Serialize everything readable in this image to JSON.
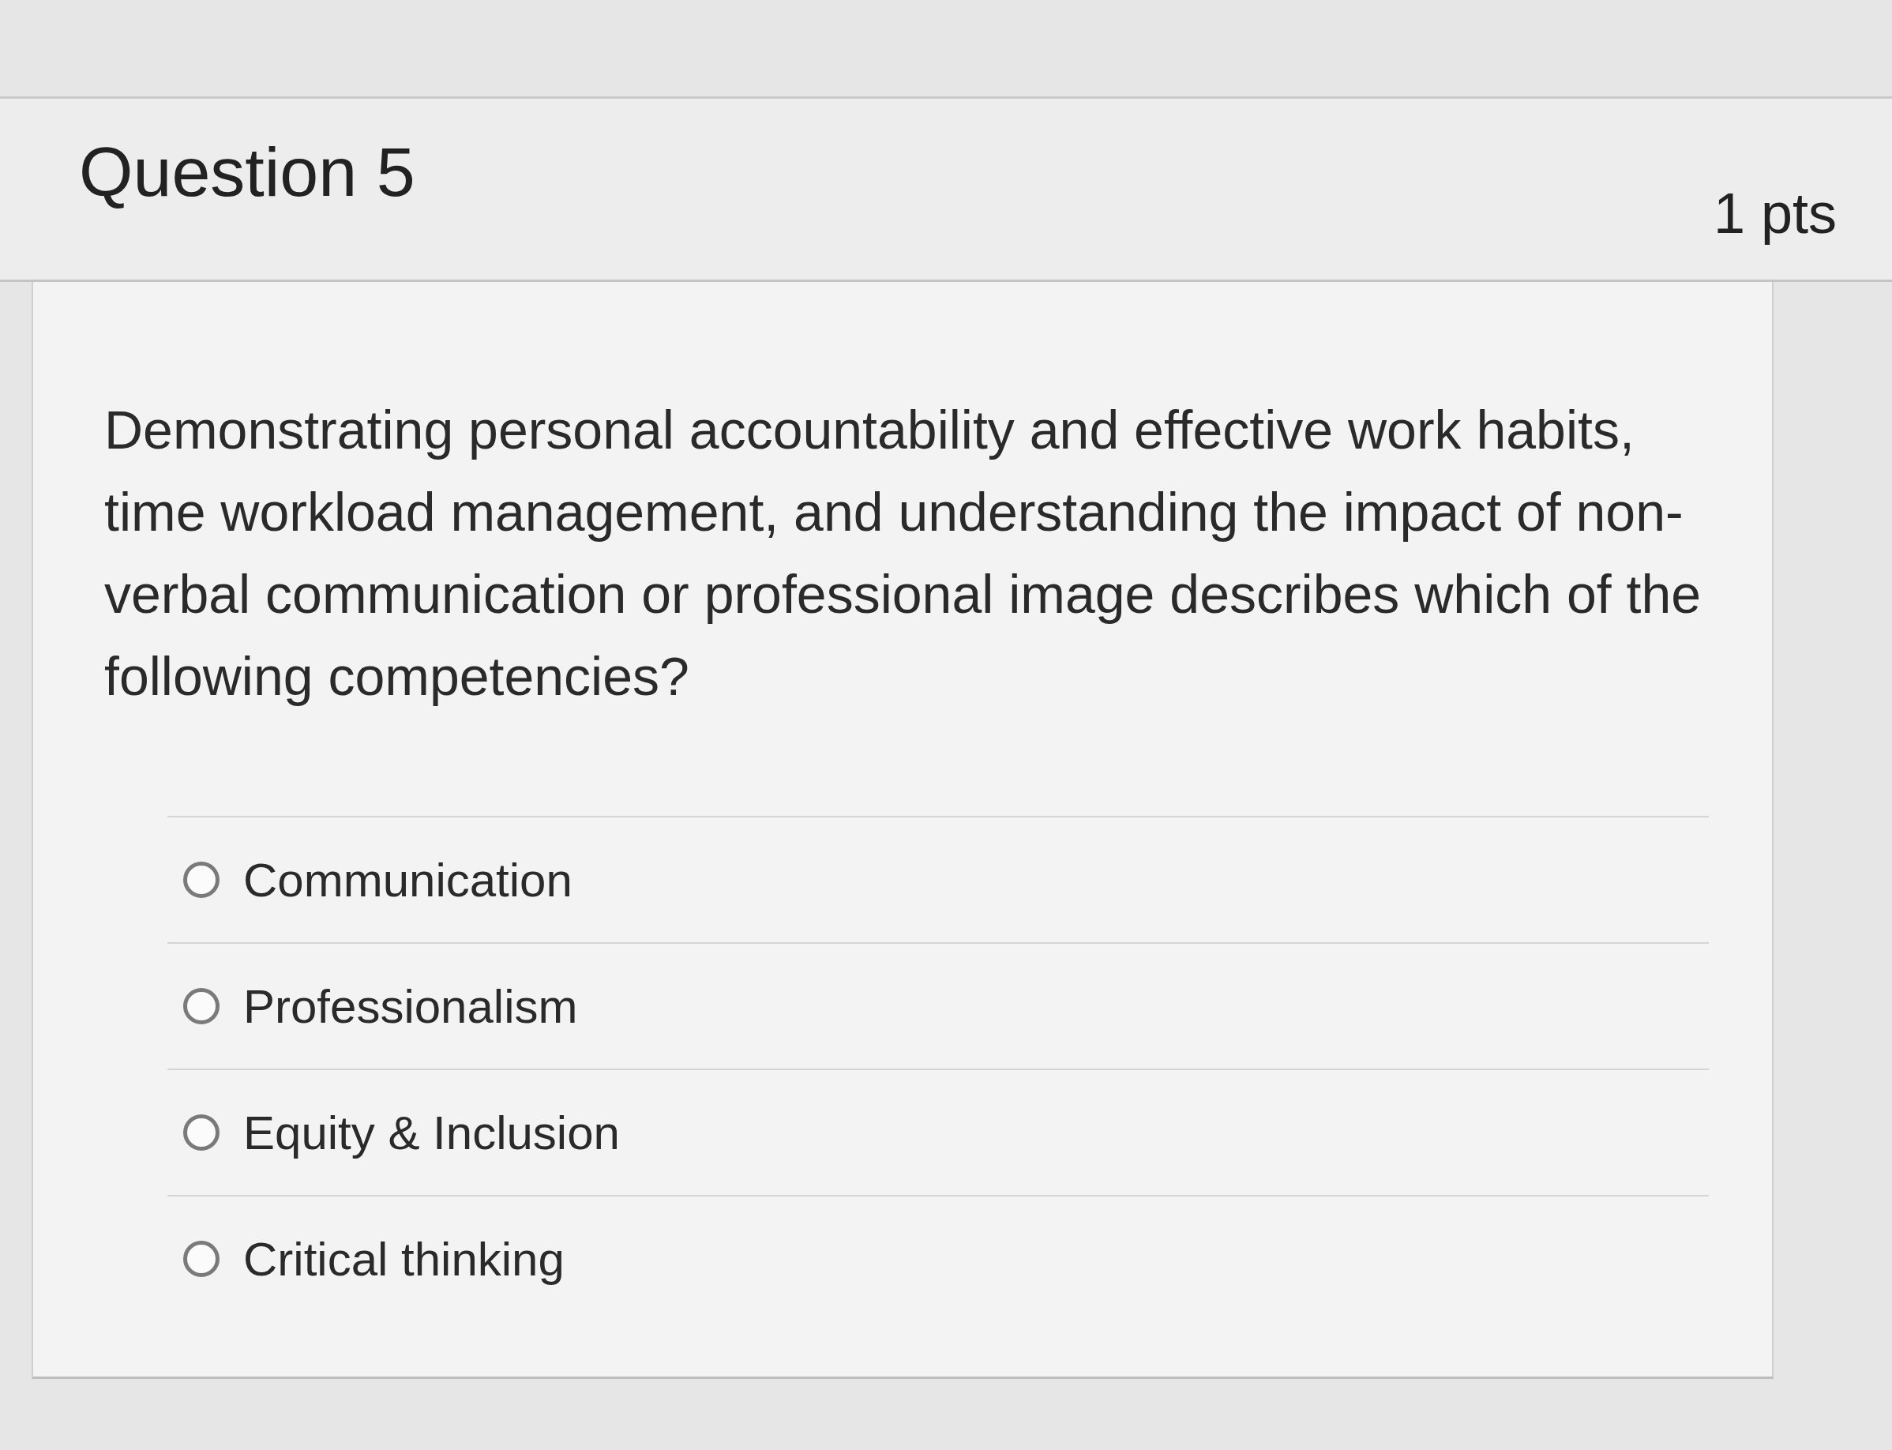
{
  "question": {
    "title": "Question 5",
    "points": "1 pts",
    "text": "Demonstrating personal accountability and effective work habits, time workload management, and understanding the impact of non-verbal communication or professional image describes which of the following competencies?"
  },
  "answers": [
    {
      "label": "Communication",
      "selected": false
    },
    {
      "label": "Professionalism",
      "selected": false
    },
    {
      "label": "Equity & Inclusion",
      "selected": false
    },
    {
      "label": "Critical thinking",
      "selected": false
    }
  ]
}
